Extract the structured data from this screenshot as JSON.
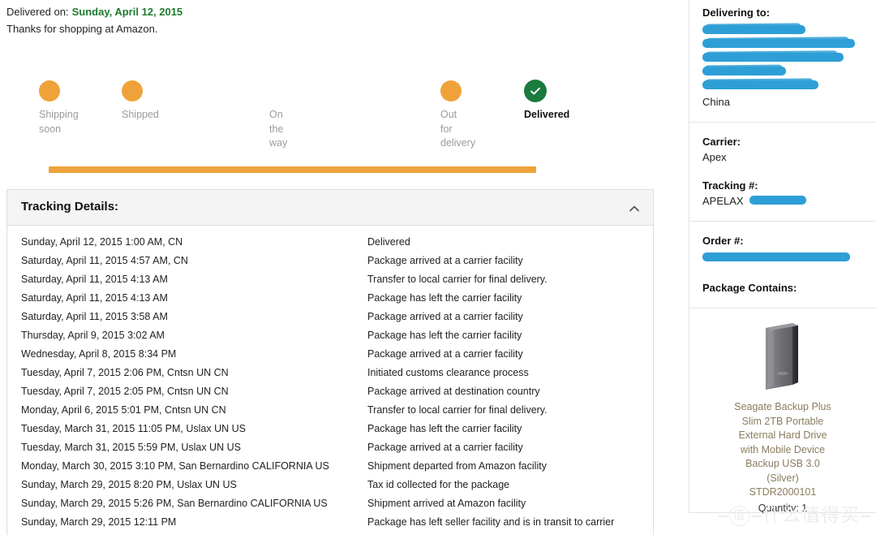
{
  "header": {
    "delivered_label": "Delivered on:",
    "delivered_date": "Sunday, April 12, 2015",
    "thanks": "Thanks for shopping at Amazon."
  },
  "tracker": {
    "steps": [
      {
        "label": "Shipping soon",
        "state": "done"
      },
      {
        "label": "Shipped",
        "state": "done"
      },
      {
        "label": "On the way",
        "state": "skipped"
      },
      {
        "label": "Out for delivery",
        "state": "done"
      },
      {
        "label": "Delivered",
        "state": "current"
      }
    ],
    "colors": {
      "bar": "#eda33a",
      "dot": "#f0a23a",
      "delivered": "#1b7a3d",
      "label": "#9b9b9b"
    }
  },
  "tracking_details": {
    "title": "Tracking Details:",
    "collapse_icon": "chevron-up-icon",
    "events": [
      {
        "when": "Sunday, April 12, 2015 1:00 AM,   CN",
        "what": "Delivered"
      },
      {
        "when": "Saturday, April 11, 2015 4:57 AM,   CN",
        "what": "Package arrived at a carrier facility"
      },
      {
        "when": "Saturday, April 11, 2015 4:13 AM",
        "what": "Transfer to local carrier for final delivery."
      },
      {
        "when": "Saturday, April 11, 2015 4:13 AM",
        "what": "Package has left the carrier facility"
      },
      {
        "when": "Saturday, April 11, 2015 3:58 AM",
        "what": "Package arrived at a carrier facility"
      },
      {
        "when": "Thursday, April 9, 2015 3:02 AM",
        "what": "Package has left the carrier facility"
      },
      {
        "when": "Wednesday, April 8, 2015 8:34 PM",
        "what": "Package arrived at a carrier facility"
      },
      {
        "when": "Tuesday, April 7, 2015 2:06 PM, Cntsn UN CN",
        "what": "Initiated customs clearance process"
      },
      {
        "when": "Tuesday, April 7, 2015 2:05 PM, Cntsn UN CN",
        "what": "Package arrived at destination country"
      },
      {
        "when": "Monday, April 6, 2015 5:01 PM, Cntsn UN CN",
        "what": "Transfer to local carrier for final delivery."
      },
      {
        "when": "Tuesday, March 31, 2015 11:05 PM, Uslax UN US",
        "what": "Package has left the carrier facility"
      },
      {
        "when": "Tuesday, March 31, 2015 5:59 PM, Uslax UN US",
        "what": "Package arrived at a carrier facility"
      },
      {
        "when": "Monday, March 30, 2015 3:10 PM, San Bernardino CALIFORNIA US",
        "what": "Shipment departed from Amazon facility"
      },
      {
        "when": "Sunday, March 29, 2015 8:20 PM, Uslax UN US",
        "what": "Tax id collected for the package"
      },
      {
        "when": "Sunday, March 29, 2015 5:26 PM, San Bernardino CALIFORNIA US",
        "what": "Shipment arrived at Amazon facility"
      },
      {
        "when": "Sunday, March 29, 2015 12:11 PM",
        "what": "Package has left seller facility and is in transit to carrier"
      }
    ]
  },
  "sidebar": {
    "delivering_to_heading": "Delivering to:",
    "address_redacted_lines": 5,
    "country": "China",
    "carrier_heading": "Carrier:",
    "carrier_value": "Apex",
    "tracking_heading": "Tracking #:",
    "tracking_value_prefix": "APELAX",
    "order_heading": "Order #:",
    "package_contains_heading": "Package Contains:",
    "product": {
      "image_icon": "external-hard-drive-image",
      "title": "Seagate Backup Plus Slim 2TB Portable External Hard Drive with Mobile Device Backup USB 3.0 (Silver)",
      "sku": "STDR2000101",
      "quantity": "Quantity: 1"
    },
    "redaction_color": "#2e9fd6"
  },
  "watermark": {
    "circle_glyph": "值",
    "text": "什么值得买"
  }
}
